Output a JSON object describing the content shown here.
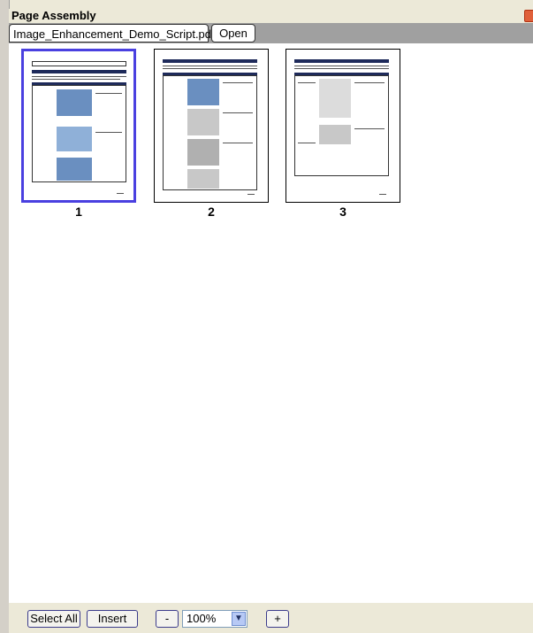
{
  "window": {
    "title": "Page Assembly"
  },
  "tabs": [
    {
      "label": "Image_Enhancement_Demo_Script.pdf",
      "close": "X"
    }
  ],
  "open_button": "Open",
  "pages": [
    {
      "number": "1",
      "selected": true
    },
    {
      "number": "2",
      "selected": false
    },
    {
      "number": "3",
      "selected": false
    }
  ],
  "toolbar": {
    "select_all": "Select All",
    "insert": "Insert",
    "zoom_out": "-",
    "zoom_value": "100%",
    "zoom_in": "+"
  },
  "colors": {
    "selection": "#4a40e0",
    "close_x": "#d00000"
  }
}
